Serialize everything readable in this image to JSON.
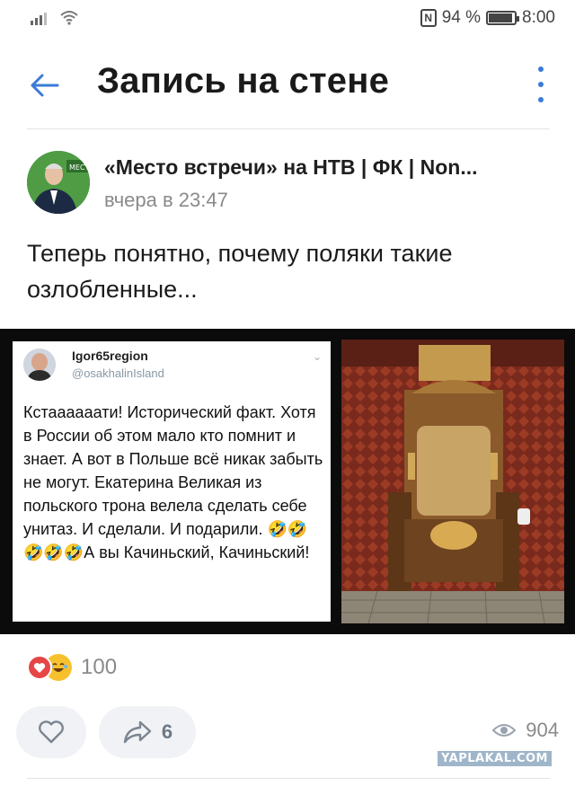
{
  "status_bar": {
    "battery_percent": "94 %",
    "battery_level": 0.94,
    "time": "8:00",
    "icons": [
      "signal-icon",
      "wifi-icon",
      "nfc-icon",
      "battery-icon"
    ]
  },
  "header": {
    "title": "Запись на стене",
    "back_icon": "arrow-left-icon",
    "more_icon": "more-vertical-icon"
  },
  "post": {
    "author": "«Место встречи» на НТВ | ФК | Non...",
    "time": "вчера в 23:47",
    "text": "Теперь понятно, почему поляки такие озлобленные...",
    "image": {
      "tweet_name": "Igor65region",
      "tweet_handle": "@osakhalinIsland",
      "tweet_text": "Кстаааааати! Исторический факт. Хотя в России об этом мало кто помнит и знает. А вот в Польше всё никак забыть не могут. Екатерина Великая из польского трона велела сделать себе унитаз. И сделали. И подарили. 🤣🤣🤣🤣🤣А вы Качиньский, Качиньский!"
    },
    "reactions": {
      "count": "100",
      "icons": [
        "heart-reaction-icon",
        "laugh-reaction-icon"
      ]
    },
    "share_count": "6",
    "views": "904"
  },
  "watermark": "YAPLAKAL.COM",
  "colors": {
    "accent": "#3a7bd5",
    "heart": "#e64646",
    "pill_bg": "#f0f2f5",
    "muted": "#8a8a8a"
  }
}
